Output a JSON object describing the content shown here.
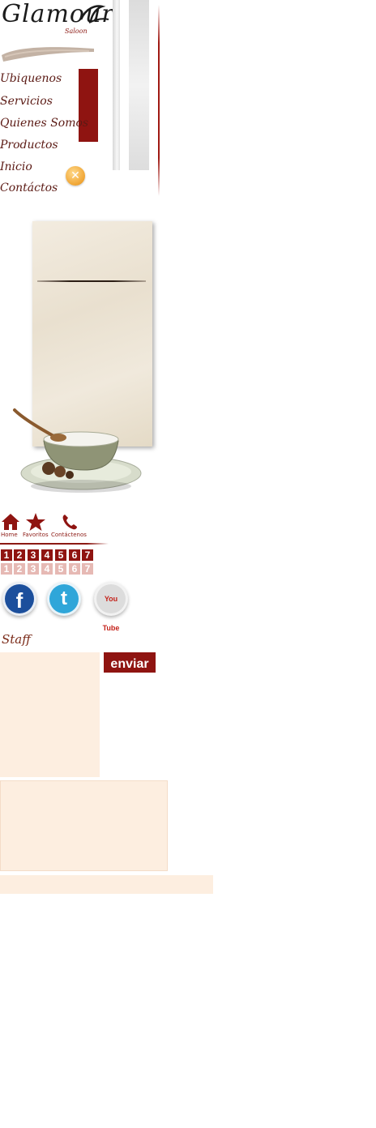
{
  "brand": {
    "name": "Glamour",
    "sub": "Saloon"
  },
  "menu": [
    {
      "label": "Ubiquenos"
    },
    {
      "label": "Servicios"
    },
    {
      "label": "Quienes Somos"
    },
    {
      "label": "Productos"
    },
    {
      "label": "Inicio"
    },
    {
      "label": "Contáctos"
    }
  ],
  "close_glyph": "✕",
  "quick_links": [
    {
      "label": "Home",
      "icon": "home-icon"
    },
    {
      "label": "Favoritos",
      "icon": "star-icon"
    },
    {
      "label": "Contáctenos",
      "icon": "phone-icon"
    }
  ],
  "pager": {
    "pages": [
      "1",
      "2",
      "3",
      "4",
      "5",
      "6",
      "7"
    ]
  },
  "social": [
    {
      "icon": "facebook-icon",
      "glyph": "f"
    },
    {
      "icon": "twitter-icon",
      "glyph": "t"
    },
    {
      "icon": "youtube-icon",
      "glyph": "You Tube"
    }
  ],
  "staff": {
    "title": "Staff",
    "send_label": "enviar"
  },
  "colors": {
    "accent_red": "#8f1411",
    "menu_text": "#5b1a14",
    "panel_bg": "#fdeee0",
    "pager_light": "#e6b9b4"
  }
}
